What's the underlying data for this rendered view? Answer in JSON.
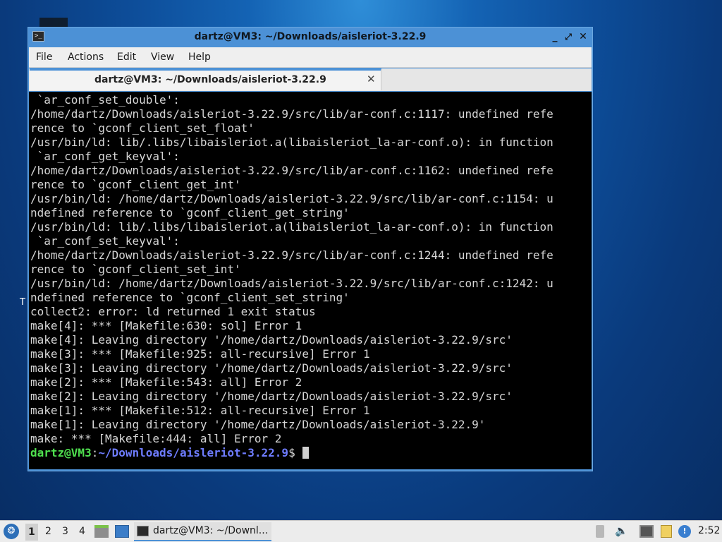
{
  "desktop": {
    "stray_letter": "T"
  },
  "window": {
    "title": "dartz@VM3: ~/Downloads/aisleriot-3.22.9",
    "icon": "terminal-icon",
    "buttons": {
      "minimize": "_",
      "maximize": "⤢",
      "close": "✕"
    },
    "menu": [
      "File",
      "Actions",
      "Edit",
      "View",
      "Help"
    ],
    "tab": {
      "label": "dartz@VM3: ~/Downloads/aisleriot-3.22.9",
      "close": "✕"
    }
  },
  "terminal": {
    "lines": [
      " `ar_conf_set_double':",
      "/home/dartz/Downloads/aisleriot-3.22.9/src/lib/ar-conf.c:1117: undefined refe",
      "rence to `gconf_client_set_float'",
      "/usr/bin/ld: lib/.libs/libaisleriot.a(libaisleriot_la-ar-conf.o): in function",
      " `ar_conf_get_keyval':",
      "/home/dartz/Downloads/aisleriot-3.22.9/src/lib/ar-conf.c:1162: undefined refe",
      "rence to `gconf_client_get_int'",
      "/usr/bin/ld: /home/dartz/Downloads/aisleriot-3.22.9/src/lib/ar-conf.c:1154: u",
      "ndefined reference to `gconf_client_get_string'",
      "/usr/bin/ld: lib/.libs/libaisleriot.a(libaisleriot_la-ar-conf.o): in function",
      " `ar_conf_set_keyval':",
      "/home/dartz/Downloads/aisleriot-3.22.9/src/lib/ar-conf.c:1244: undefined refe",
      "rence to `gconf_client_set_int'",
      "/usr/bin/ld: /home/dartz/Downloads/aisleriot-3.22.9/src/lib/ar-conf.c:1242: u",
      "ndefined reference to `gconf_client_set_string'",
      "collect2: error: ld returned 1 exit status",
      "make[4]: *** [Makefile:630: sol] Error 1",
      "make[4]: Leaving directory '/home/dartz/Downloads/aisleriot-3.22.9/src'",
      "make[3]: *** [Makefile:925: all-recursive] Error 1",
      "make[3]: Leaving directory '/home/dartz/Downloads/aisleriot-3.22.9/src'",
      "make[2]: *** [Makefile:543: all] Error 2",
      "make[2]: Leaving directory '/home/dartz/Downloads/aisleriot-3.22.9/src'",
      "make[1]: *** [Makefile:512: all-recursive] Error 1",
      "make[1]: Leaving directory '/home/dartz/Downloads/aisleriot-3.22.9'",
      "make: *** [Makefile:444: all] Error 2"
    ],
    "prompt": {
      "user": "dartz@VM3",
      "sep": ":",
      "path": "~/Downloads/aisleriot-3.22.9",
      "dollar": "$"
    }
  },
  "taskbar": {
    "start_icon": "start-menu-icon",
    "workspaces": [
      "1",
      "2",
      "3",
      "4"
    ],
    "launchers": [
      "file-manager-icon",
      "show-desktop-icon"
    ],
    "task": {
      "label": "dartz@VM3: ~/Downl...",
      "icon": "terminal-icon"
    },
    "tray": [
      "scroll-icon",
      "volume-icon",
      "network-icon",
      "clipboard-icon",
      "notification-icon"
    ],
    "notify_glyph": "!",
    "clock": "2:52"
  }
}
